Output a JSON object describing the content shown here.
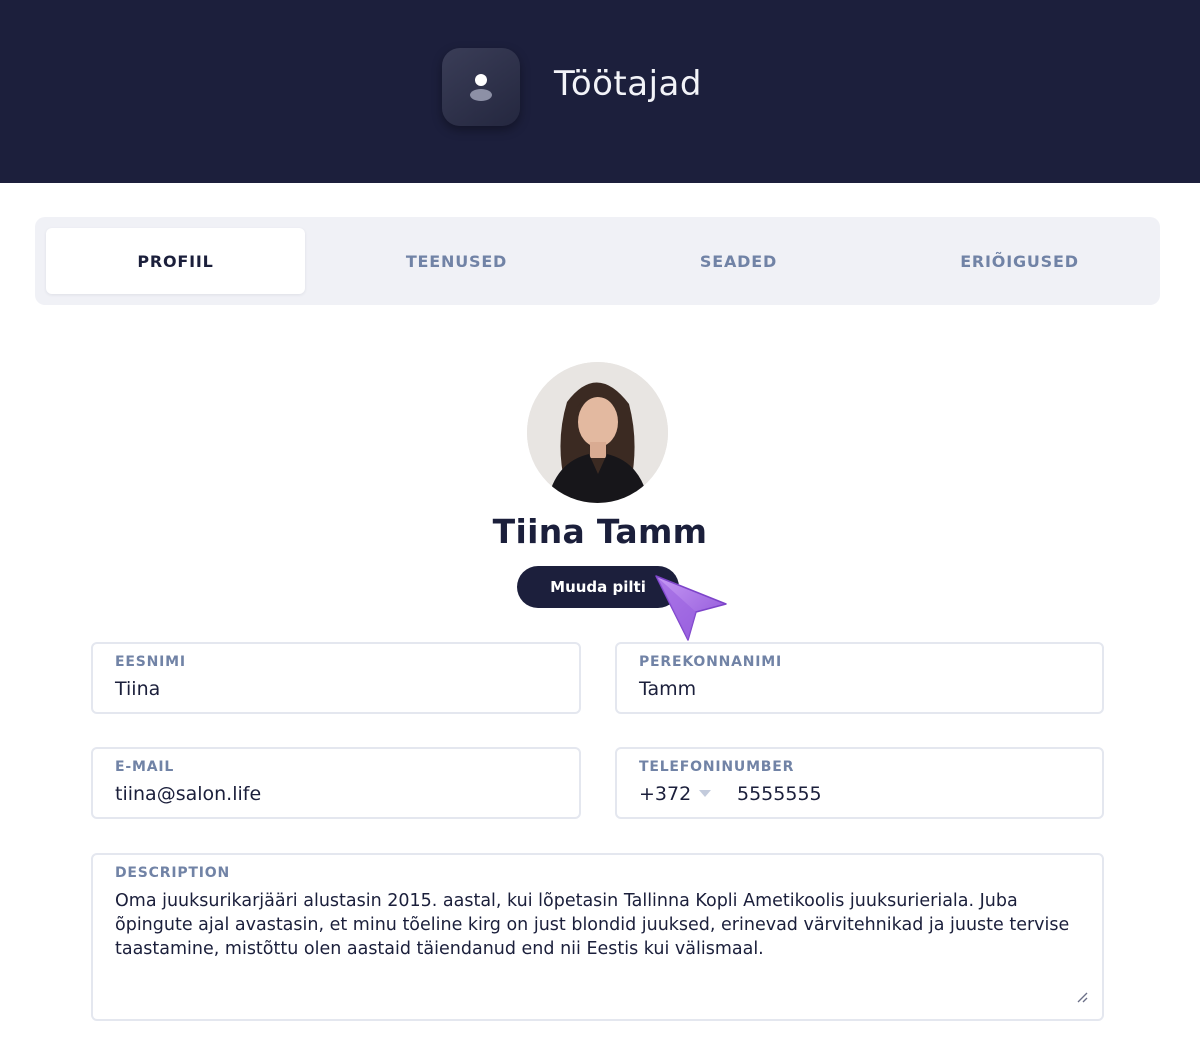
{
  "header": {
    "title": "Töötajad",
    "icon": "user-icon",
    "background": "#1c1f3c"
  },
  "tabs": [
    {
      "label": "PROFIIL",
      "active": true
    },
    {
      "label": "TEENUSED",
      "active": false
    },
    {
      "label": "SEADED",
      "active": false
    },
    {
      "label": "ERIÕIGUSED",
      "active": false
    }
  ],
  "profile": {
    "name": "Tiina Tamm",
    "change_picture_label": "Muuda pilti",
    "avatar": "profile-photo"
  },
  "form": {
    "first_name": {
      "label": "EESNIMI",
      "value": "Tiina"
    },
    "last_name": {
      "label": "PEREKONNANIMI",
      "value": "Tamm"
    },
    "email": {
      "label": "E-MAIL",
      "value": "tiina@salon.life"
    },
    "phone": {
      "label": "TELEFONINUMBER",
      "country_code": "+372",
      "number": "5555555"
    },
    "description": {
      "label": "DESCRIPTION",
      "value": "Oma juuksurikarjääri alustasin 2015. aastal, kui lõpetasin Tallinna Kopli Ametikoolis juuksurieriala. Juba õpingute ajal avastasin, et minu tõeline kirg on just blondid juuksed, erinevad värvitehnikad ja juuste tervise taastamine, mistõttu olen aastaid täiendanud end nii Eestis kui välismaal."
    }
  },
  "colors": {
    "accent": "#1c1f3c",
    "label": "#7183a6",
    "cursor": "#a46ee8"
  }
}
